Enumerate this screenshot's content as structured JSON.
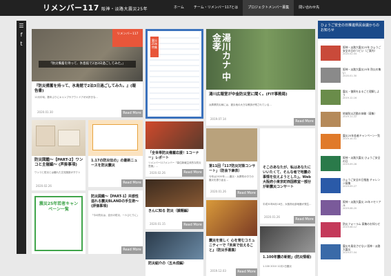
{
  "header": {
    "logo": "リメンバー117",
    "logo_sub": "阪神・淡路大震災25年",
    "nav": [
      "ホーム",
      "チーム・リメンバー117とは",
      "プロジェクトメンバー募集",
      "問い合わせ先"
    ]
  },
  "social": {
    "icons": [
      "hamburger-icon",
      "facebook-icon",
      "twitter-icon"
    ],
    "glyphs": [
      "☰",
      "f",
      "t"
    ]
  },
  "cards": [
    {
      "title": "『防災備蓄を持って、氷島館で2泊3日過ごしてみた。』(報告書)",
      "badge": "リメンバー117",
      "thumb_caption": "「防災備蓄を持って、氷島館で2泊3日過ごしてみた。」",
      "excerpt": "12月中旬、数年ぶりにキャンプやアウトドアが大好きな...",
      "date": "2020.01.30",
      "more": "Read More"
    },
    {
      "title": "震災25年特集",
      "excerpt": "",
      "date": "",
      "more": ""
    },
    {
      "title": "湯川広報室が中金防災室に聞く。(FIT事務局)",
      "thumb_caption": "湯川カナ 中金孝",
      "excerpt": "兵庫県防災局には、被災地の大きな教訓が残されている...",
      "date": "2019.07.14",
      "more": "Read More"
    },
    {
      "title": "防災図鑑～【PART-2】ワンコと主催編～ (声掛事項)",
      "excerpt": "ワンコと防災とは離れた交流施設がダクト",
      "date": "2020.02.26",
      "more": "Read More"
    },
    {
      "title": "「全世帯防災備蓄応援！1コーナー」レポート",
      "excerpt": "リメンバー117メンバー「暮住新報主体的な防災意識」...",
      "date": "2020.02.26",
      "more": "Read More"
    },
    {
      "title": "第11回「117防災対策コンサート」（防会下衆表）",
      "excerpt": "今年は2020年――震災・兵庫県の中での震災を振り返る...",
      "date": "2020.01.26",
      "more": "Read More"
    },
    {
      "title": "そこのあなたが、私はあなたにいいたくて、そんな者で地震の事情を伝えようとした」。Web 大阪府小東京町西国教室一部分が新震災コンサート",
      "excerpt": "平成30年6月18日、大阪府北部地震が発生...",
      "date": "2020.01.26",
      "more": "Read More"
    },
    {
      "title": "防災図鑑～【PART-1】共感性溢れる震災BLANDの手生術～ (評価事項)",
      "excerpt": "「今の防災は、自分の防災、一人ひとりに」",
      "date": "",
      "more": "Read More"
    },
    {
      "title": "きんに知る 防災（課題編）",
      "excerpt": "",
      "date": "2020.01.15",
      "more": "Read More"
    },
    {
      "title": "震災を楽しく 心を育むコミュニティーで『未来で伝えること』（防災手募集）",
      "excerpt": "",
      "date": "2019.12.03",
      "more": "Read More"
    },
    {
      "title": "1.17の防災伝の」の最新ニュースを防災震災",
      "excerpt": "",
      "date": "",
      "more": ""
    },
    {
      "title": "防災紹介の（五木成編）",
      "excerpt": "",
      "date": "",
      "more": ""
    },
    {
      "title": "1.100年震の新館」(防災情報)",
      "excerpt": "1.100 2010 12月1日震災",
      "date": "",
      "more": ""
    },
    {
      "title": "震災25年若者キャンペーン一覧",
      "excerpt": "",
      "date": "",
      "more": ""
    }
  ],
  "sidebar": {
    "heading": "ひょうご安全の日推進県民会議からのお知らせ",
    "items": [
      {
        "text": "阪神・淡路大震災25年 ひょうご安全の日のつどい（ご案内）",
        "date": "2020.02.04"
      },
      {
        "text": "阪神・淡路大震災25年 防災の集い",
        "date": "2020.01.30"
      },
      {
        "text": "震災・復興をまるごと理解しよう",
        "date": "2019.12.16"
      },
      {
        "text": "地域防災活動の体験（募集）",
        "date": "2019.11.22"
      },
      {
        "text": "震災25年若者キャンペーン一覧",
        "date": "2019.10.31"
      },
      {
        "text": "阪神・淡路大震災 ひょうご安全の日",
        "date": "2019.09.28"
      },
      {
        "text": "ひょうご安全の日推進 チャレンジ募集",
        "date": "2019.09.27"
      },
      {
        "text": "阪神・淡路大震災 25年メモリアル",
        "date": "2019.08.20"
      },
      {
        "text": "防災フォーラム 募集のお知らせ",
        "date": "2019.08.12"
      },
      {
        "text": "震災を風化させない 阪神・淡路大震災",
        "date": "2019.07.04"
      }
    ]
  }
}
